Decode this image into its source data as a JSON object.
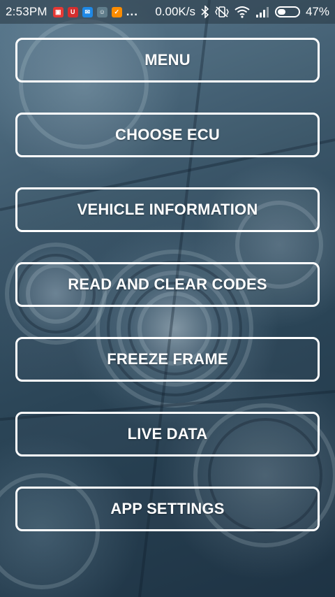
{
  "status_bar": {
    "time": "2:53PM",
    "net_speed": "0.00K/s",
    "battery_percent": "47%",
    "more": "...",
    "notification_icons": [
      "red-app-icon",
      "red-shield-icon",
      "blue-app-icon",
      "gray-app-icon",
      "orange-app-icon"
    ],
    "system_icons": [
      "bluetooth-icon",
      "vibrate-mute-icon",
      "wifi-icon",
      "signal-icon",
      "battery-icon"
    ],
    "battery_level": 0.47
  },
  "menu": {
    "items": [
      {
        "label": "MENU"
      },
      {
        "label": "CHOOSE ECU"
      },
      {
        "label": "VEHICLE INFORMATION"
      },
      {
        "label": "READ AND CLEAR CODES"
      },
      {
        "label": "FREEZE FRAME"
      },
      {
        "label": "LIVE DATA"
      },
      {
        "label": "APP SETTINGS"
      }
    ]
  },
  "colors": {
    "button_border": "#ffffff",
    "button_text": "#ffffff",
    "background": "#2d4658"
  }
}
